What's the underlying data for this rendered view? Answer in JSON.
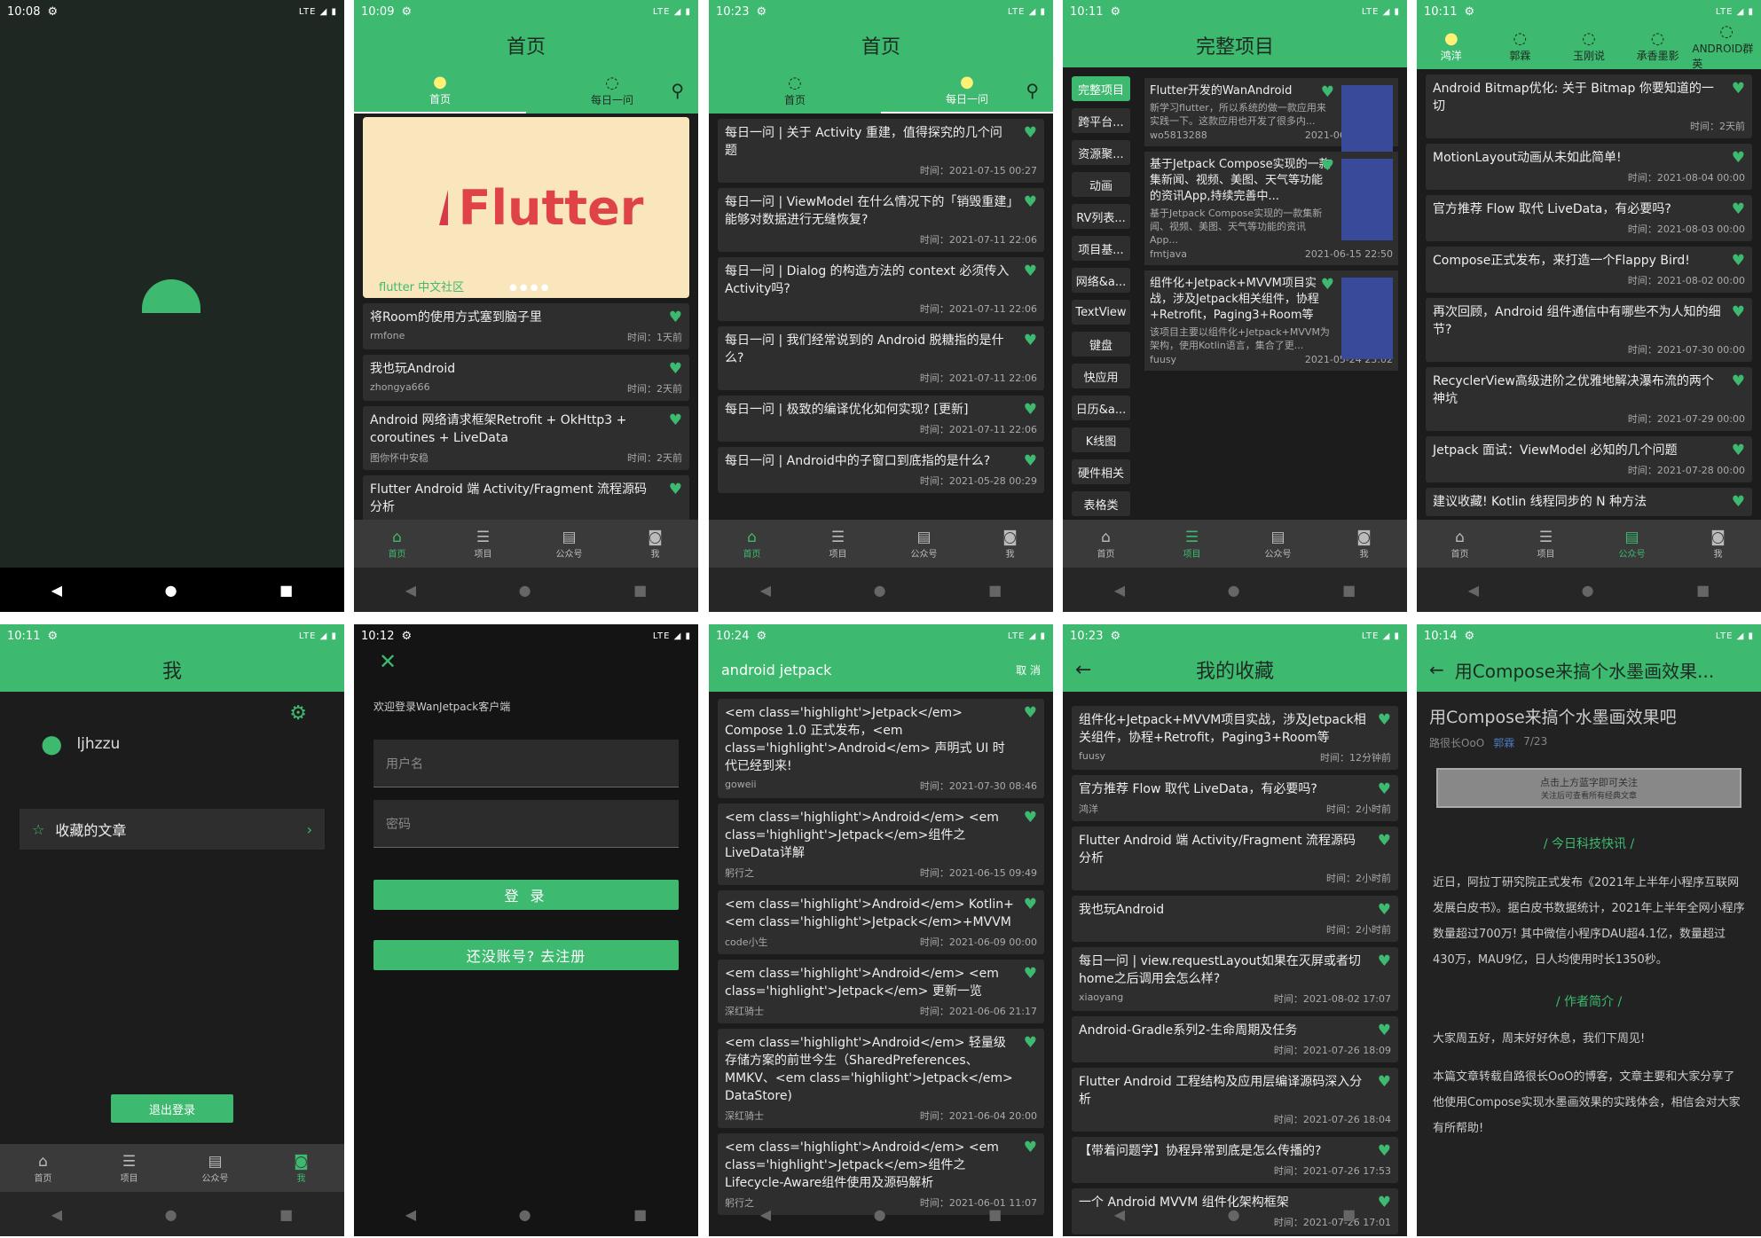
{
  "s1": {
    "time": "10:08"
  },
  "s2": {
    "time": "10:09",
    "title": "首页",
    "tabs": [
      "首页",
      "每日一问"
    ],
    "banner_text": "Flutter",
    "banner_caption": "flutter 中文社区",
    "items": [
      {
        "t": "将Room的使用方式塞到脑子里",
        "a": "rmfone",
        "d": "时间：1天前"
      },
      {
        "t": "我也玩Android",
        "a": "zhongya666",
        "d": "时间：2天前"
      },
      {
        "t": "Android 网络请求框架Retrofit + OkHttp3 + coroutines + LiveData",
        "a": "图你怀中安稳",
        "d": "时间：2天前"
      },
      {
        "t": "Flutter Android 端 Activity/Fragment 流程源码分析",
        "a": "",
        "d": ""
      }
    ]
  },
  "s3": {
    "time": "10:23",
    "title": "首页",
    "tabs": [
      "首页",
      "每日一问"
    ],
    "items": [
      {
        "t": "每日一问 | 关于 Activity 重建，值得探究的几个问题",
        "d": "时间：2021-07-15 00:27"
      },
      {
        "t": "每日一问 | ViewModel 在什么情况下的「销毁重建」能够对数据进行无缝恢复?",
        "d": "时间：2021-07-11 22:06"
      },
      {
        "t": "每日一问 | Dialog 的构造方法的 context 必须传入 Activity吗?",
        "d": "时间：2021-07-11 22:06"
      },
      {
        "t": "每日一问 | 我们经常说到的 Android 脱糖指的是什么?",
        "d": "时间：2021-07-11 22:06"
      },
      {
        "t": "每日一问 | 极致的编译优化如何实现? [更新]",
        "d": "时间：2021-07-11 22:06"
      },
      {
        "t": "每日一问 | Android中的子窗口到底指的是什么?",
        "d": "时间：2021-05-28 00:29"
      }
    ]
  },
  "s4": {
    "time": "10:11",
    "title": "完整项目",
    "side": [
      "完整项目",
      "跨平台...",
      "资源聚...",
      "动画",
      "RV列表...",
      "项目基...",
      "网络&a...",
      "TextView",
      "键盘",
      "快应用",
      "日历&a...",
      "K线图",
      "硬件相关",
      "表格类"
    ],
    "items": [
      {
        "t": "Flutter开发的WanAndroid",
        "d": "新学习flutter，所以系统的做一款应用来实践一下。这款应用也开发了很多内...",
        "a": "wo5813288",
        "dt": "2021-06-15 22:51"
      },
      {
        "t": "基于Jetpack Compose实现的一款集新闻、视频、美图、天气等功能的资讯App,持续完善中...",
        "d": "基于Jetpack Compose实现的一款集新闻、视频、美图、天气等功能的资讯App...",
        "a": "fmtjava",
        "dt": "2021-06-15 22:50"
      },
      {
        "t": "组件化+Jetpack+MVVM项目实战，涉及Jetpack相关组件，协程+Retrofit，Paging3+Room等",
        "d": "该项目主要以组件化+Jetpack+MVVM为架构，使用Kotlin语言，集合了更...",
        "a": "fuusy",
        "dt": "2021-05-24 23:02"
      }
    ]
  },
  "s5": {
    "time": "10:11",
    "tabs": [
      "鸿洋",
      "郭霖",
      "玉刚说",
      "承香墨影",
      "ANDROID群英"
    ],
    "items": [
      {
        "t": "Android Bitmap优化: 关于 Bitmap 你要知道的一切",
        "d": "时间：2天前"
      },
      {
        "t": "MotionLayout动画从未如此简单!",
        "d": "时间：2021-08-04 00:00"
      },
      {
        "t": "官方推荐 Flow 取代 LiveData，有必要吗?",
        "d": "时间：2021-08-03 00:00"
      },
      {
        "t": "Compose正式发布，来打造一个Flappy Bird!",
        "d": "时间：2021-08-02 00:00"
      },
      {
        "t": "再次回顾，Android 组件通信中有哪些不为人知的细节?",
        "d": "时间：2021-07-30 00:00"
      },
      {
        "t": "RecyclerView高级进阶之优雅地解决瀑布流的两个神坑",
        "d": "时间：2021-07-29 00:00"
      },
      {
        "t": "Jetpack 面试：ViewModel 必知的几个问题",
        "d": "时间：2021-07-28 00:00"
      },
      {
        "t": "建议收藏! Kotlin 线程同步的 N 种方法",
        "d": ""
      }
    ]
  },
  "nav": [
    "首页",
    "项目",
    "公众号",
    "我"
  ],
  "s6": {
    "time": "10:11",
    "title": "我",
    "user": "ljhzzu",
    "fav": "收藏的文章",
    "logout": "退出登录"
  },
  "s7": {
    "time": "10:12",
    "welcome": "欢迎登录WanJetpack客户端",
    "user_ph": "用户名",
    "pwd_ph": "密码",
    "login": "登 录",
    "register": "还没账号? 去注册"
  },
  "s8": {
    "time": "10:24",
    "query": "android jetpack",
    "cancel": "取 消",
    "items": [
      {
        "t": "<em class='highlight'>Jetpack</em> Compose 1.0 正式发布，<em class='highlight'>Android</em> 声明式 UI 时代已经到来!",
        "a": "goweii",
        "d": "时间：2021-07-30 08:46"
      },
      {
        "t": "<em class='highlight'>Android</em> <em class='highlight'>Jetpack</em>组件之LiveData详解",
        "a": "躬行之",
        "d": "时间：2021-06-15 09:49"
      },
      {
        "t": "<em class='highlight'>Android</em> Kotlin+<em class='highlight'>Jetpack</em>+MVVM",
        "a": "code小生",
        "d": "时间：2021-06-09 00:00"
      },
      {
        "t": "<em class='highlight'>Android</em> <em class='highlight'>Jetpack</em> 更新一览",
        "a": "深红骑士",
        "d": "时间：2021-06-06 21:17"
      },
      {
        "t": "<em class='highlight'>Android</em> 轻量级存储方案的前世今生（SharedPreferences、MMKV、<em class='highlight'>Jetpack</em> DataStore)",
        "a": "深红骑士",
        "d": "时间：2021-06-04 20:00"
      },
      {
        "t": "<em class='highlight'>Android</em> <em class='highlight'>Jetpack</em>组件之Lifecycle-Aware组件使用及源码解析",
        "a": "躬行之",
        "d": "时间：2021-06-01 11:07"
      }
    ]
  },
  "s9": {
    "time": "10:23",
    "title": "我的收藏",
    "items": [
      {
        "t": "组件化+Jetpack+MVVM项目实战，涉及Jetpack相关组件，协程+Retrofit，Paging3+Room等",
        "a": "fuusy",
        "d": "时间：12分钟前"
      },
      {
        "t": "官方推荐 Flow 取代 LiveData，有必要吗?",
        "a": "鸿洋",
        "d": "时间：2小时前"
      },
      {
        "t": "Flutter Android 端 Activity/Fragment 流程源码分析",
        "a": "",
        "d": "时间：2小时前"
      },
      {
        "t": "我也玩Android",
        "a": "",
        "d": "时间：2小时前"
      },
      {
        "t": "每日一问 | view.requestLayout如果在灭屏或者切home之后调用会怎么样?",
        "a": "xiaoyang",
        "d": "时间：2021-08-02 17:07"
      },
      {
        "t": "Android-Gradle系列2-生命周期及任务",
        "a": "",
        "d": "时间：2021-07-26 18:09"
      },
      {
        "t": "Flutter Android 工程结构及应用层编译源码深入分析",
        "a": "",
        "d": "时间：2021-07-26 18:04"
      },
      {
        "t": "【带着问题学】协程异常到底是怎么传播的?",
        "a": "",
        "d": "时间：2021-07-26 17:53"
      },
      {
        "t": "一个 Android MVVM 组件化架构框架",
        "a": "",
        "d": "时间：2021-07-26 17:01"
      }
    ]
  },
  "s10": {
    "time": "10:14",
    "title": "用Compose来搞个水墨画效果...",
    "h1": "用Compose来搞个水墨画效果吧",
    "author": "路很长OoO",
    "src": "郭霖",
    "date": "7/23",
    "follow1": "点击上方蓝字即可关注",
    "follow2": "关注后可查看所有经典文章",
    "sec1": "今日科技快讯",
    "p1": "近日，阿拉丁研究院正式发布《2021年上半年小程序互联网发展白皮书》。据白皮书数据统计，2021年上半年全网小程序数量超过700万! 其中微信小程序DAU超4.1亿，数量超过430万，MAU9亿，日人均使用时长1350秒。",
    "sec2": "作者简介",
    "p2": "大家周五好，周末好好休息，我们下周见!",
    "p3": "本篇文章转载自路很长OoO的博客，文章主要和大家分享了他使用Compose实现水墨画效果的实践体会，相信会对大家有所帮助!"
  }
}
